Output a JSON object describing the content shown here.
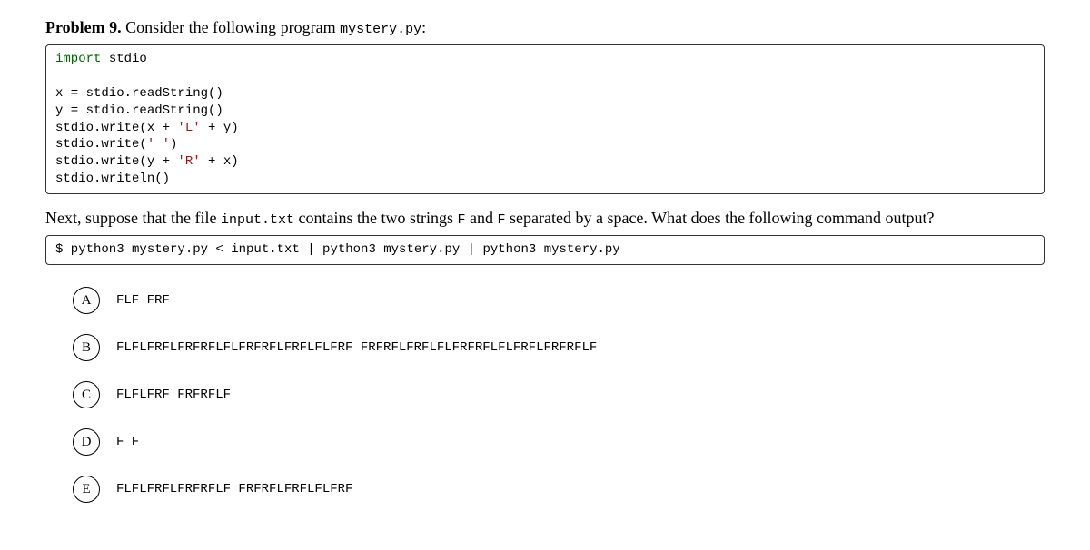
{
  "problem": {
    "label": "Problem 9.",
    "intro_text": "Consider the following program",
    "filename": "mystery.py",
    "colon": ":"
  },
  "code": {
    "l1a": "import",
    "l1b": " stdio",
    "l2": "",
    "l3": "x = stdio.readString()",
    "l4": "y = stdio.readString()",
    "l5a": "stdio.write(x + ",
    "l5b": "'L'",
    "l5c": " + y)",
    "l6a": "stdio.write(",
    "l6b": "' '",
    "l6c": ")",
    "l7a": "stdio.write(y + ",
    "l7b": "'R'",
    "l7c": " + x)",
    "l8": "stdio.writeln()"
  },
  "question": {
    "pre": "Next, suppose that the file ",
    "file": "input.txt",
    "mid1": " contains the two strings ",
    "s1": "F",
    "mid2": " and ",
    "s2": "F",
    "post": " separated by a space. What does the following command output?"
  },
  "command": "$ python3 mystery.py < input.txt | python3 mystery.py | python3 mystery.py",
  "choices": {
    "A": {
      "letter": "A",
      "text": "FLF FRF"
    },
    "B": {
      "letter": "B",
      "text": "FLFLFRFLFRFRFLFLFRFRFLFRFLFLFRF FRFRFLFRFLFLFRFRFLFLFRFLFRFRFLF"
    },
    "C": {
      "letter": "C",
      "text": "FLFLFRF FRFRFLF"
    },
    "D": {
      "letter": "D",
      "text": "F F"
    },
    "E": {
      "letter": "E",
      "text": "FLFLFRFLFRFRFLF FRFRFLFRFLFLFRF"
    }
  }
}
